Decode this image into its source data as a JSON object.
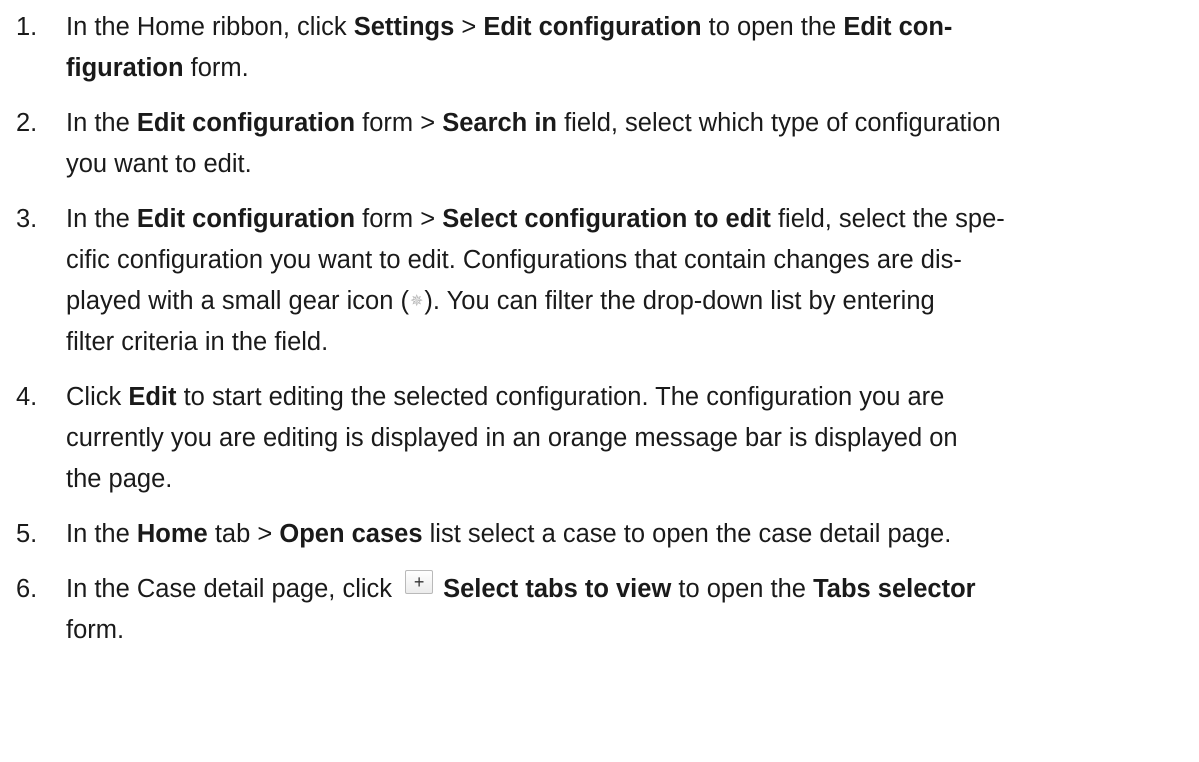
{
  "steps": [
    {
      "n": "1.",
      "t": [
        {
          "s": "In the Home ribbon, click "
        },
        {
          "b": "Settings"
        },
        {
          "s": " > "
        },
        {
          "b": "Edit configuration"
        },
        {
          "s": " to open the "
        },
        {
          "b": "Edit con-"
        },
        {
          "br": true
        },
        {
          "b": "figuration"
        },
        {
          "s": " form."
        }
      ]
    },
    {
      "n": "2.",
      "t": [
        {
          "s": "In the "
        },
        {
          "b": "Edit configuration"
        },
        {
          "s": " form > "
        },
        {
          "b": "Search in"
        },
        {
          "s": " field, select which type of configuration"
        },
        {
          "br": true
        },
        {
          "s": "you want to edit."
        }
      ]
    },
    {
      "n": "3.",
      "t": [
        {
          "s": "In the "
        },
        {
          "b": "Edit configuration"
        },
        {
          "s": " form > "
        },
        {
          "b": "Select configuration to edit"
        },
        {
          "s": " field, select the spe-"
        },
        {
          "br": true
        },
        {
          "s": "cific configuration you want to edit. Configurations that contain changes are dis-"
        },
        {
          "br": true
        },
        {
          "s": "played with a small gear icon ("
        },
        {
          "icon": "gear"
        },
        {
          "s": "). You can filter the drop-down list by entering"
        },
        {
          "br": true
        },
        {
          "s": "filter criteria in the field."
        }
      ]
    },
    {
      "n": "4.",
      "t": [
        {
          "s": "Click "
        },
        {
          "b": "Edit"
        },
        {
          "s": " to start editing the selected configuration. The configuration you are"
        },
        {
          "br": true
        },
        {
          "s": "currently you are editing is displayed in an orange message bar is displayed on"
        },
        {
          "br": true
        },
        {
          "s": "the page."
        }
      ]
    },
    {
      "n": "5.",
      "t": [
        {
          "s": "In the "
        },
        {
          "b": "Home"
        },
        {
          "s": " tab > "
        },
        {
          "b": "Open cases"
        },
        {
          "s": " list select a case to open the case detail page."
        }
      ]
    },
    {
      "n": "6.",
      "t": [
        {
          "s": "In the Case detail page, click "
        },
        {
          "icon": "plus"
        },
        {
          "b": "Select tabs to view"
        },
        {
          "s": "  to open the "
        },
        {
          "b": "Tabs selector"
        },
        {
          "br": true
        },
        {
          "s": "form."
        }
      ]
    }
  ],
  "icons": {
    "gear": "✵",
    "plus": "+"
  }
}
